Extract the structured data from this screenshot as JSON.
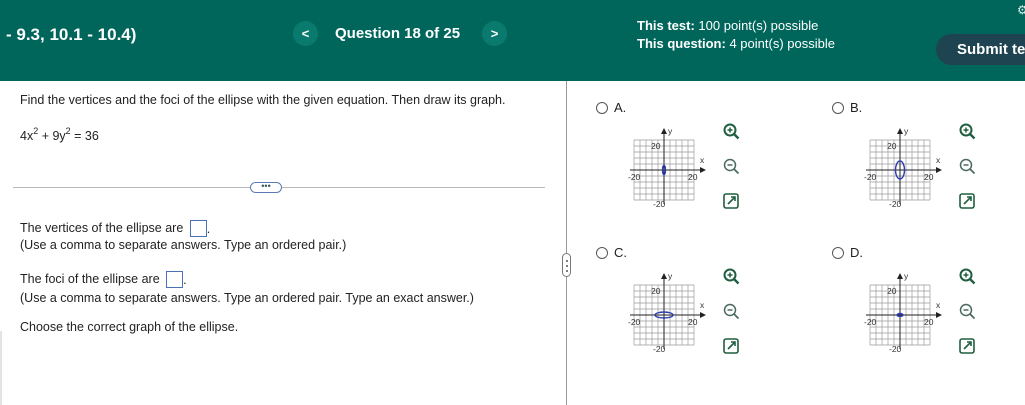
{
  "header": {
    "homework_title": "- 9.3, 10.1 - 10.4)",
    "prev_symbol": "<",
    "next_symbol": ">",
    "question_counter": "Question 18 of 25",
    "test_points_label": "This test:",
    "test_points_value": "100 point(s) possible",
    "question_points_label": "This question:",
    "question_points_value": "4 point(s) possible",
    "submit_label": "Submit te",
    "settings_glyph": "⚙"
  },
  "question": {
    "instruction": "Find the vertices and the foci of the ellipse with the given equation. Then draw its graph.",
    "equation": {
      "a": "4x",
      "exp1": "2",
      "b": " + 9y",
      "exp2": "2",
      "rhs": " = 36"
    },
    "more_label": "•••",
    "vertices_prompt": "The vertices of the ellipse are",
    "vertices_hint": "(Use a comma to separate answers. Type an ordered pair.)",
    "foci_prompt": "The foci of the ellipse are",
    "foci_hint": "(Use a comma to separate answers. Type an ordered pair. Type an exact answer.)",
    "choose_prompt": "Choose the correct graph of the ellipse.",
    "period": "."
  },
  "options": [
    {
      "label": "A.",
      "ellipse": {
        "cx": 0,
        "cy": 0,
        "rx": 1,
        "ry": 3
      }
    },
    {
      "label": "B.",
      "ellipse": {
        "cx": 0,
        "cy": 0,
        "rx": 3,
        "ry": 6
      }
    },
    {
      "label": "C.",
      "ellipse": {
        "cx": 0,
        "cy": 0,
        "rx": 6,
        "ry": 2
      }
    },
    {
      "label": "D.",
      "ellipse": {
        "cx": 0,
        "cy": 0,
        "rx": 2,
        "ry": 1
      }
    }
  ],
  "graph_axes": {
    "x_label": "x",
    "y_label": "y",
    "range": [
      -20,
      20
    ],
    "tick_pos": "20",
    "tick_neg": "-20"
  },
  "colors": {
    "header_bg": "#00665b",
    "ellipse": "#2c3eb0",
    "submit_bg": "#1d4450"
  },
  "icons": {
    "zoom_in": "zoom-in-icon",
    "zoom_out": "zoom-out-icon",
    "expand": "expand-icon"
  }
}
